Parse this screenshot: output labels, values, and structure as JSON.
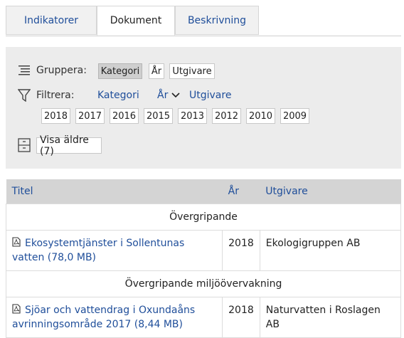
{
  "tabs": [
    {
      "label": "Indikatorer"
    },
    {
      "label": "Dokument"
    },
    {
      "label": "Beskrivning"
    }
  ],
  "group": {
    "label": "Gruppera:",
    "options": [
      "Kategori",
      "År",
      "Utgivare"
    ],
    "selected": "Kategori"
  },
  "filter": {
    "label": "Filtrera:",
    "links": [
      "Kategori",
      "År",
      "Utgivare"
    ],
    "years": [
      "2018",
      "2017",
      "2016",
      "2015",
      "2013",
      "2012",
      "2010",
      "2009"
    ]
  },
  "older": {
    "label": "Visa äldre (7)"
  },
  "table": {
    "headers": {
      "title": "Titel",
      "year": "År",
      "publisher": "Utgivare"
    },
    "groups": [
      {
        "name": "Övergripande",
        "rows": [
          {
            "title": "Ekosystemtjänster i Sollentunas vatten (78,0 MB)",
            "year": "2018",
            "publisher": "Ekologigruppen AB"
          }
        ]
      },
      {
        "name": "Övergripande miljöövervakning",
        "rows": [
          {
            "title": "Sjöar och vattendrag i Oxundaåns avrinningsområde 2017 (8,44 MB)",
            "year": "2018",
            "publisher": "Naturvatten i Roslagen AB"
          }
        ]
      }
    ]
  },
  "colors": {
    "link": "#1f4e9a",
    "panel": "#ececec",
    "header": "#d4d4d4"
  }
}
